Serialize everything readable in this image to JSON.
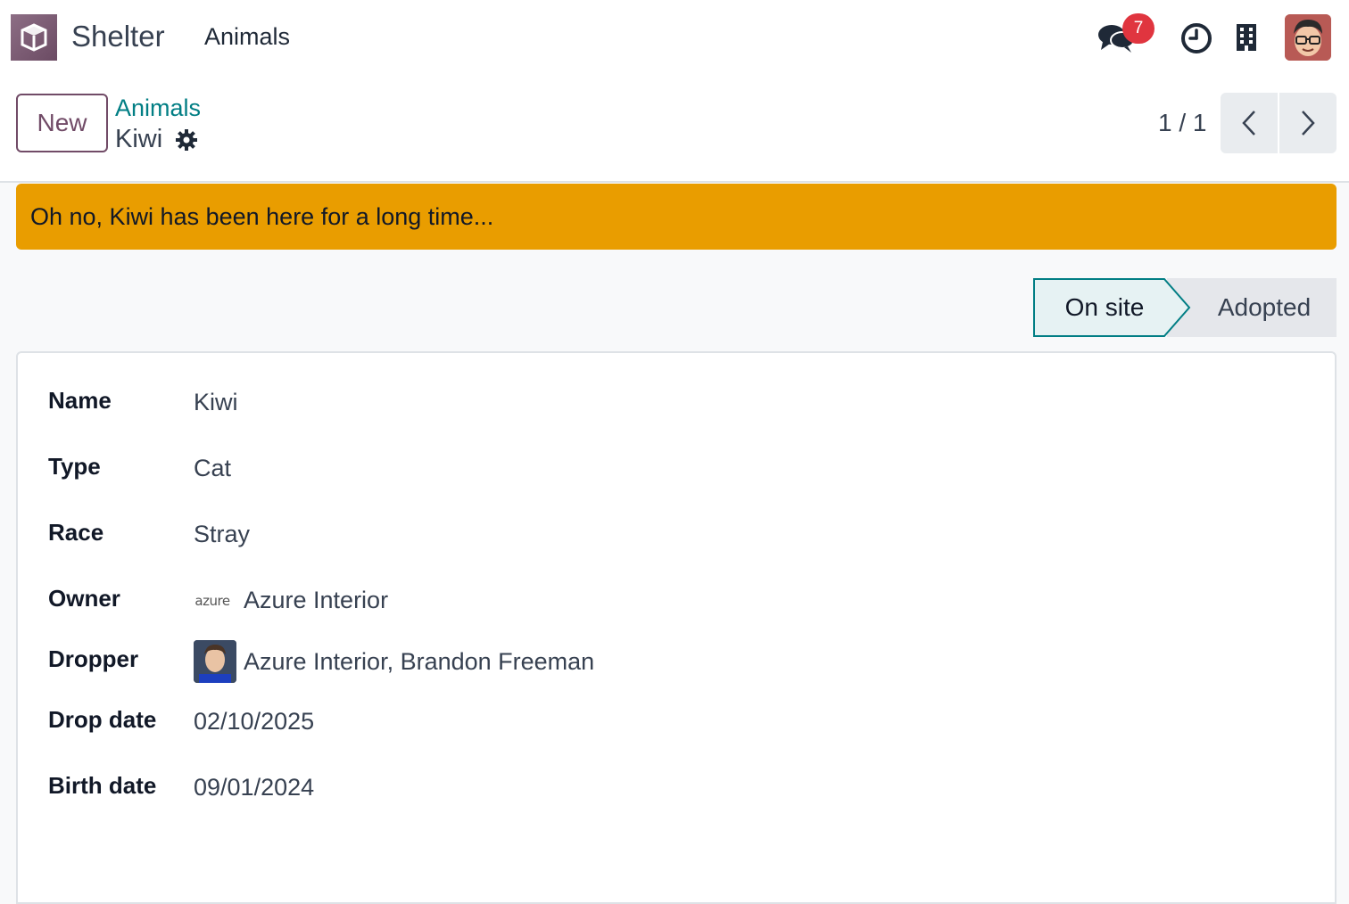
{
  "navbar": {
    "app_name": "Shelter",
    "menu": [
      "Animals"
    ],
    "message_badge_count": "7",
    "icons": [
      "app-logo-icon",
      "chat-icon",
      "clock-icon",
      "building-icon",
      "user-avatar"
    ]
  },
  "control_panel": {
    "new_button": "New",
    "breadcrumb": "Animals",
    "record_title": "Kiwi",
    "pager": "1 / 1"
  },
  "alert": {
    "text": "Oh no, Kiwi has been here for a long time...",
    "color": "#e99d00"
  },
  "statusbar": {
    "stages": [
      "On site",
      "Adopted"
    ],
    "active_stage": "On site"
  },
  "form": {
    "fields": [
      {
        "label": "Name",
        "value": "Kiwi"
      },
      {
        "label": "Type",
        "value": "Cat"
      },
      {
        "label": "Race",
        "value": "Stray"
      },
      {
        "label": "Owner",
        "value": "Azure Interior",
        "logo_text": "azure"
      },
      {
        "label": "Dropper",
        "value": "Azure Interior, Brandon Freeman"
      },
      {
        "label": "Drop date",
        "value": "02/10/2025"
      },
      {
        "label": "Birth date",
        "value": "09/01/2024"
      }
    ]
  },
  "colors": {
    "brand": "#714b67",
    "link": "#017e84",
    "badge": "#e0353f"
  }
}
